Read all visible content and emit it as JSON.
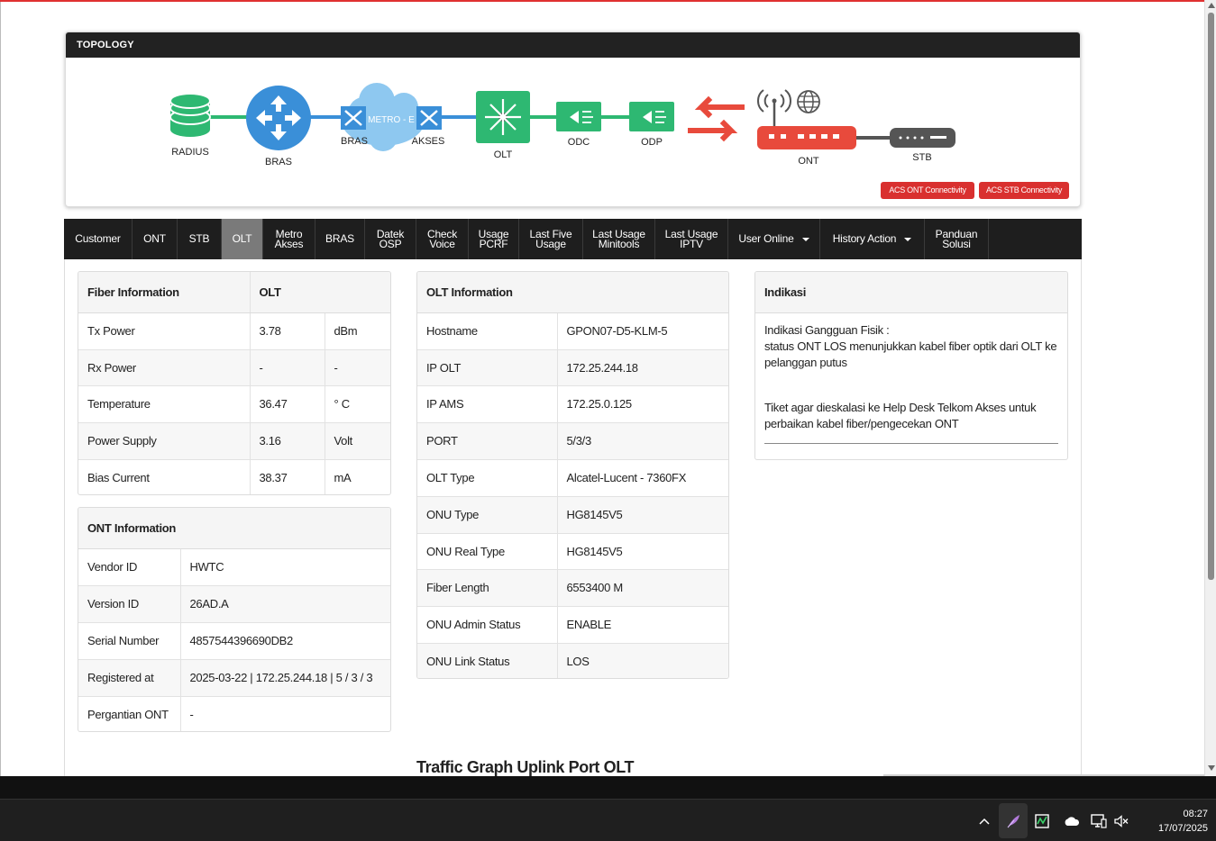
{
  "topology": {
    "title": "TOPOLOGY",
    "nodes": {
      "radius": "RADIUS",
      "bras": "BRAS",
      "bras_small": "BRAS",
      "metro": "METRO - E",
      "akses": "AKSES",
      "olt": "OLT",
      "odc": "ODC",
      "odp": "ODP",
      "ont": "ONT",
      "stb": "STB"
    },
    "buttons": {
      "acs_ont": "ACS ONT Connectivity",
      "acs_stb": "ACS STB Connectivity"
    }
  },
  "tabs": [
    {
      "label": "Customer"
    },
    {
      "label": "ONT"
    },
    {
      "label": "STB"
    },
    {
      "label": "OLT",
      "active": true
    },
    {
      "label": "Metro Akses"
    },
    {
      "label": "BRAS"
    },
    {
      "label": "Datek OSP"
    },
    {
      "label": "Check Voice"
    },
    {
      "label": "Usage PCRF"
    },
    {
      "label": "Last Five Usage"
    },
    {
      "label": "Last Usage Minitools"
    },
    {
      "label": "Last Usage IPTV"
    },
    {
      "label": "User Online"
    },
    {
      "label": "History Action"
    },
    {
      "label": "Panduan Solusi"
    }
  ],
  "fiber": {
    "header_1": "Fiber Information",
    "header_2": "OLT",
    "rows": [
      {
        "label": "Tx Power",
        "value": "3.78",
        "unit": "dBm"
      },
      {
        "label": "Rx Power",
        "value": "-",
        "unit": "-"
      },
      {
        "label": "Temperature",
        "value": "36.47",
        "unit": "° C"
      },
      {
        "label": "Power Supply",
        "value": "3.16",
        "unit": "Volt"
      },
      {
        "label": "Bias Current",
        "value": "38.37",
        "unit": "mA"
      }
    ]
  },
  "ont_info": {
    "header": "ONT Information",
    "rows": [
      {
        "label": "Vendor ID",
        "value": "HWTC"
      },
      {
        "label": "Version ID",
        "value": "26AD.A"
      },
      {
        "label": "Serial Number",
        "value": "4857544396690DB2"
      },
      {
        "label": "Registered at",
        "value": "2025-03-22 | 172.25.244.18 | 5 / 3 / 3"
      },
      {
        "label": "Pergantian ONT",
        "value": "-"
      }
    ]
  },
  "olt_info": {
    "header": "OLT Information",
    "rows": [
      {
        "label": "Hostname",
        "value": "GPON07-D5-KLM-5"
      },
      {
        "label": "IP OLT",
        "value": "172.25.244.18"
      },
      {
        "label": "IP AMS",
        "value": "172.25.0.125"
      },
      {
        "label": "PORT",
        "value": "5/3/3"
      },
      {
        "label": "OLT Type",
        "value": "Alcatel-Lucent - 7360FX"
      },
      {
        "label": "ONU Type",
        "value": "HG8145V5"
      },
      {
        "label": "ONU Real Type",
        "value": "HG8145V5"
      },
      {
        "label": "Fiber Length",
        "value": "6553400 M"
      },
      {
        "label": "ONU Admin Status",
        "value": "ENABLE"
      },
      {
        "label": "ONU Link Status",
        "value": "LOS"
      }
    ]
  },
  "indikasi": {
    "header": "Indikasi",
    "line1": "Indikasi Gangguan Fisik :",
    "line2": "status ONT LOS menunjukkan kabel fiber optik dari OLT ke pelanggan putus",
    "line3": "Tiket agar dieskalasi ke Help Desk Telkom Akses untuk perbaikan kabel fiber/pengecekan ONT"
  },
  "traffic_title": "Traffic Graph Uplink Port OLT",
  "taskbar": {
    "time": "08:27",
    "date": "17/07/2025"
  },
  "colors": {
    "green": "#2eb872",
    "blue": "#3a8fd8",
    "red": "#e84a3c",
    "dark": "#1e1e1e",
    "acs_red": "#d9302f"
  }
}
